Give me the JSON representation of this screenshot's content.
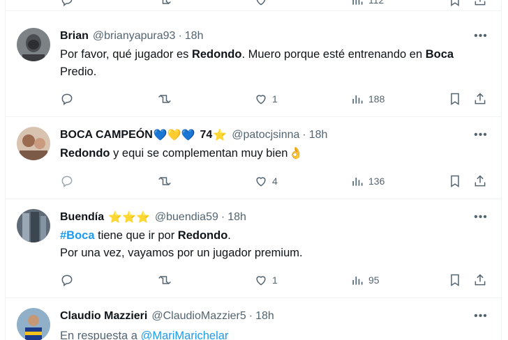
{
  "colors": {
    "accent": "#1d9bf0",
    "muted": "#536471",
    "text": "#0f1419",
    "divider": "#eff3f4"
  },
  "top_actions": {
    "views": "112"
  },
  "tweets": [
    {
      "name": "Brian",
      "handle": "@brianyapura93",
      "time": "18h",
      "text_parts": [
        "Por favor, qué jugador es ",
        "Redondo",
        ". Muero porque esté entrenando en ",
        "Boca",
        " Predio."
      ],
      "replies": "",
      "retweets": "",
      "likes": "1",
      "views": "188"
    },
    {
      "name": "BOCA CAMPEÓN",
      "name_emoji": "💙💛💙",
      "name_number": "74",
      "name_star": "⭐",
      "handle": "@patocjsinna",
      "time": "18h",
      "text_parts": [
        "Redondo",
        " y equi se complementan muy bien",
        "👌"
      ],
      "replies": "",
      "retweets": "",
      "likes": "4",
      "views": "136"
    },
    {
      "name": "Buendía",
      "name_stars": "⭐⭐⭐",
      "handle": "@buendia59",
      "time": "18h",
      "text_parts": [
        "#Boca",
        " tiene que ir por ",
        "Redondo",
        "."
      ],
      "text_line2": "Por una vez, vayamos por un jugador premium.",
      "replies": "",
      "retweets": "",
      "likes": "1",
      "views": "95"
    },
    {
      "name": "Claudio Mazzieri",
      "handle": "@ClaudioMazzier5",
      "time": "18h",
      "reply_prefix": "En respuesta a ",
      "reply_to": "@MariMarichelar"
    }
  ],
  "icons": [
    "reply-icon",
    "retweet-icon",
    "like-icon",
    "views-icon",
    "bookmark-icon",
    "share-icon",
    "more-icon"
  ]
}
